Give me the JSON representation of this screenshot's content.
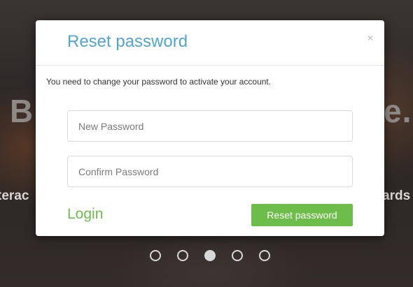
{
  "background": {
    "headline_left": "B",
    "headline_right": "e.",
    "subline_left": "terac",
    "subline_right": "ards"
  },
  "carousel": {
    "slide_count": 5,
    "active_index": 2
  },
  "modal": {
    "title": "Reset password",
    "close_icon": "×",
    "message": "You need to change your password to activate your account.",
    "new_password": {
      "placeholder": "New Password",
      "value": ""
    },
    "confirm_password": {
      "placeholder": "Confirm Password",
      "value": ""
    },
    "login_label": "Login",
    "reset_button_label": "Reset password"
  },
  "colors": {
    "title": "#4fa6d3",
    "accent_green": "#6dbd4a"
  }
}
